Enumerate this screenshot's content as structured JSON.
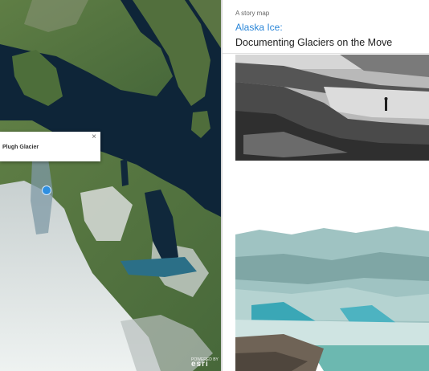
{
  "map": {
    "popup_title": "Plugh Glacier",
    "close_label": "×",
    "attribution_top": "POWERED BY",
    "attribution_brand": "esri"
  },
  "story": {
    "eyebrow": "A story map",
    "title_line1": "Alaska Ice:",
    "title_line2": "Documenting Glaciers on the Move"
  },
  "colors": {
    "title_accent": "#2a86d8",
    "water": "#0e2538",
    "marker": "#2f8fe0"
  }
}
